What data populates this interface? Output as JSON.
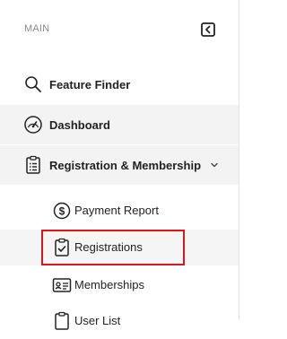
{
  "sidebar": {
    "section_label": "MAIN",
    "items": [
      {
        "label": "Feature Finder",
        "icon": "search-icon"
      },
      {
        "label": "Dashboard",
        "icon": "dashboard-gauge-icon"
      },
      {
        "label": "Registration & Membership",
        "icon": "clipboard-list-icon",
        "expanded": true
      }
    ],
    "subitems": [
      {
        "label": "Payment Report",
        "icon": "dollar-circle-icon"
      },
      {
        "label": "Registrations",
        "icon": "clipboard-check-icon",
        "highlighted": true
      },
      {
        "label": "Memberships",
        "icon": "id-card-icon"
      },
      {
        "label": "User List",
        "icon": "clipboard-user-icon"
      }
    ]
  },
  "colors": {
    "highlight_border": "#e0151c",
    "active_background": "#f3f3f3"
  }
}
